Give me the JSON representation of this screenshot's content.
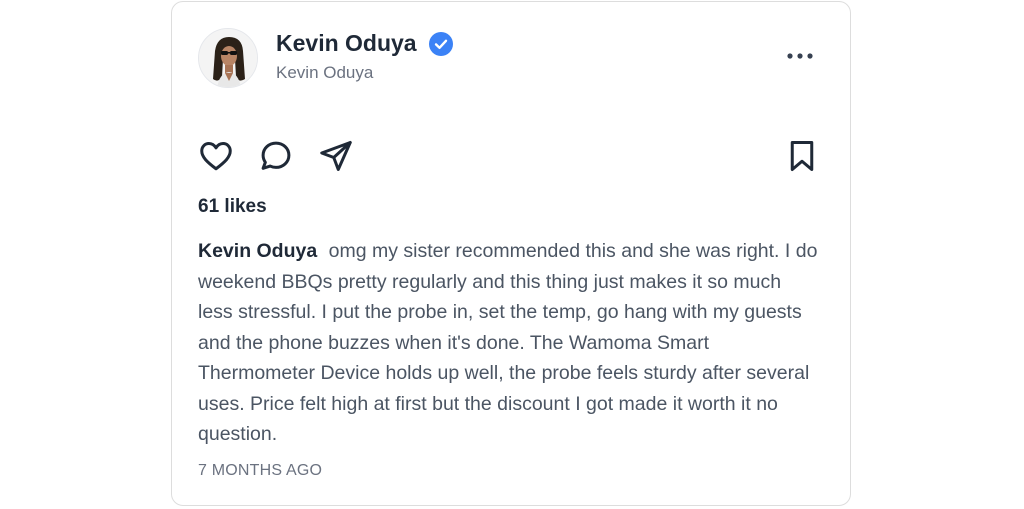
{
  "post": {
    "author": {
      "display_name": "Kevin Oduya",
      "handle": "Kevin Oduya",
      "verified": true,
      "verified_color": "#3b82f6"
    },
    "likes_text": "61 likes",
    "caption_author": "Kevin Oduya",
    "caption_text": "omg my sister recommended this and she was right. I do weekend BBQs pretty regularly and this thing just makes it so much less stressful. I put the probe in, set the temp, go hang with my guests and the phone buzzes when it's done. The Wamoma Smart Thermometer Device holds up well, the probe feels sturdy after several uses. Price felt high at first but the discount I got made it worth it no question.",
    "timestamp": "7 MONTHS AGO"
  },
  "icons": {
    "more": "more-horizontal-icon",
    "like": "heart-icon",
    "comment": "comment-icon",
    "share": "send-icon",
    "save": "bookmark-icon",
    "verified": "verified-badge-icon"
  }
}
